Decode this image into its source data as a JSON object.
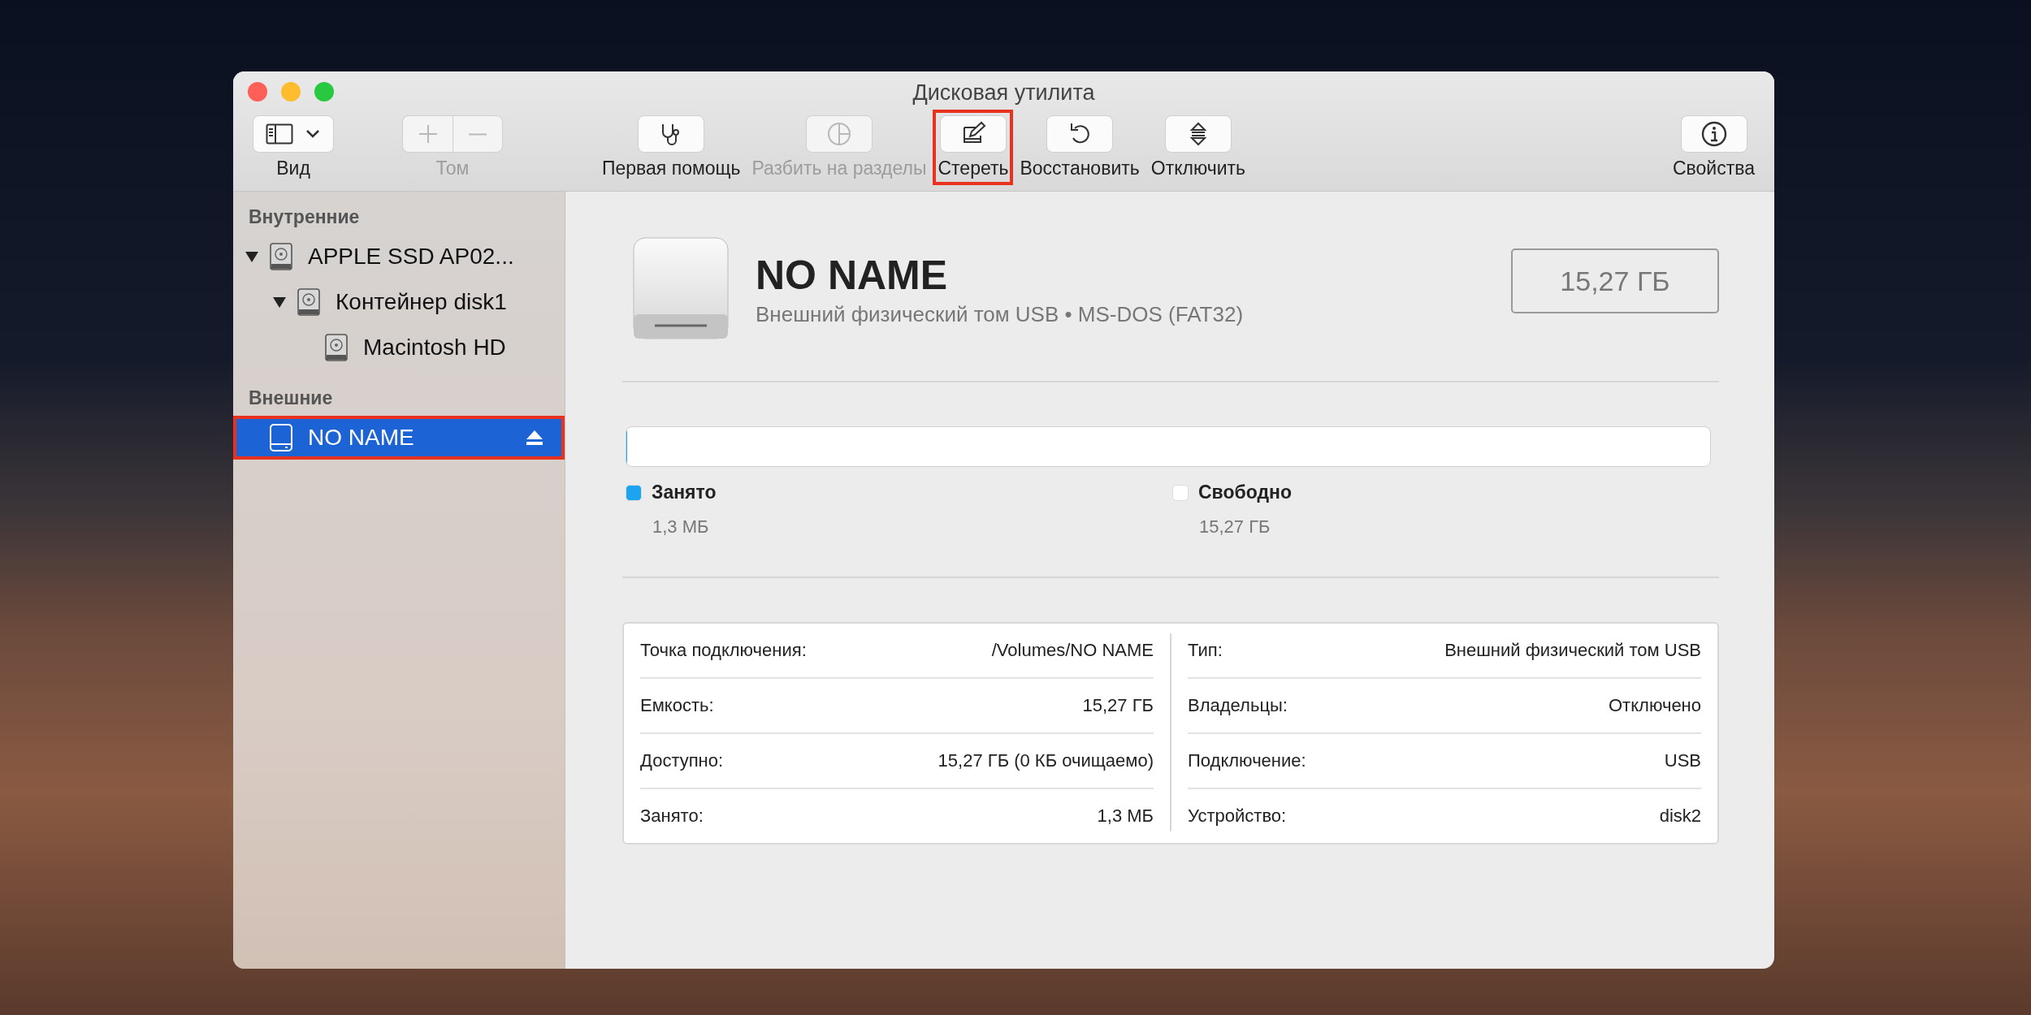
{
  "window": {
    "title": "Дисковая утилита"
  },
  "toolbar": {
    "left": [
      {
        "kind": "view",
        "label": "Вид",
        "disabled": false,
        "highlighted": false
      },
      {
        "kind": "volume",
        "label": "Том",
        "disabled": true,
        "highlighted": false
      }
    ],
    "center": [
      {
        "kind": "firstaid",
        "label": "Первая помощь",
        "disabled": false,
        "highlighted": false
      },
      {
        "kind": "partition",
        "label": "Разбить на разделы",
        "disabled": true,
        "highlighted": false
      },
      {
        "kind": "erase",
        "label": "Стереть",
        "disabled": false,
        "highlighted": true
      },
      {
        "kind": "restore",
        "label": "Восстановить",
        "disabled": false,
        "highlighted": false
      },
      {
        "kind": "unmount",
        "label": "Отключить",
        "disabled": false,
        "highlighted": false
      }
    ],
    "right": [
      {
        "kind": "info",
        "label": "Свойства",
        "disabled": false,
        "highlighted": false
      }
    ]
  },
  "sidebar": {
    "sections": [
      {
        "title": "Внутренние",
        "items": [
          {
            "kind": "disk",
            "label": "APPLE SSD AP02...",
            "selected": false,
            "highlighted": false,
            "expanded": true,
            "children": [
              {
                "kind": "disk",
                "label": "Контейнер disk1",
                "selected": false,
                "highlighted": false,
                "expanded": true,
                "children": [
                  {
                    "kind": "disk",
                    "label": "Macintosh HD",
                    "selected": false,
                    "highlighted": false
                  }
                ]
              }
            ]
          }
        ]
      },
      {
        "title": "Внешние",
        "items": [
          {
            "kind": "external",
            "label": "NO NAME",
            "selected": true,
            "highlighted": true,
            "ejectable": true
          }
        ]
      }
    ]
  },
  "volume": {
    "name": "NO NAME",
    "description": "Внешний физический том USB • MS-DOS (FAT32)",
    "capacity": "15,27 ГБ"
  },
  "usage": {
    "level": 0.001,
    "legend": [
      {
        "label": "Занято",
        "value": "1,3 МБ",
        "color": "#1ba4f0"
      },
      {
        "label": "Свободно",
        "value": "15,27 ГБ",
        "color": "#ffffff"
      }
    ]
  },
  "info": {
    "columns": [
      [
        {
          "label": "Точка подключения:",
          "value": "/Volumes/NO NAME"
        },
        {
          "label": "Емкость:",
          "value": "15,27 ГБ"
        },
        {
          "label": "Доступно:",
          "value": "15,27 ГБ (0 КБ очищаемо)"
        },
        {
          "label": "Занято:",
          "value": "1,3 МБ"
        }
      ],
      [
        {
          "label": "Тип:",
          "value": "Внешний физический том USB"
        },
        {
          "label": "Владельцы:",
          "value": "Отключено"
        },
        {
          "label": "Подключение:",
          "value": "USB"
        },
        {
          "label": "Устройство:",
          "value": "disk2"
        }
      ]
    ]
  }
}
